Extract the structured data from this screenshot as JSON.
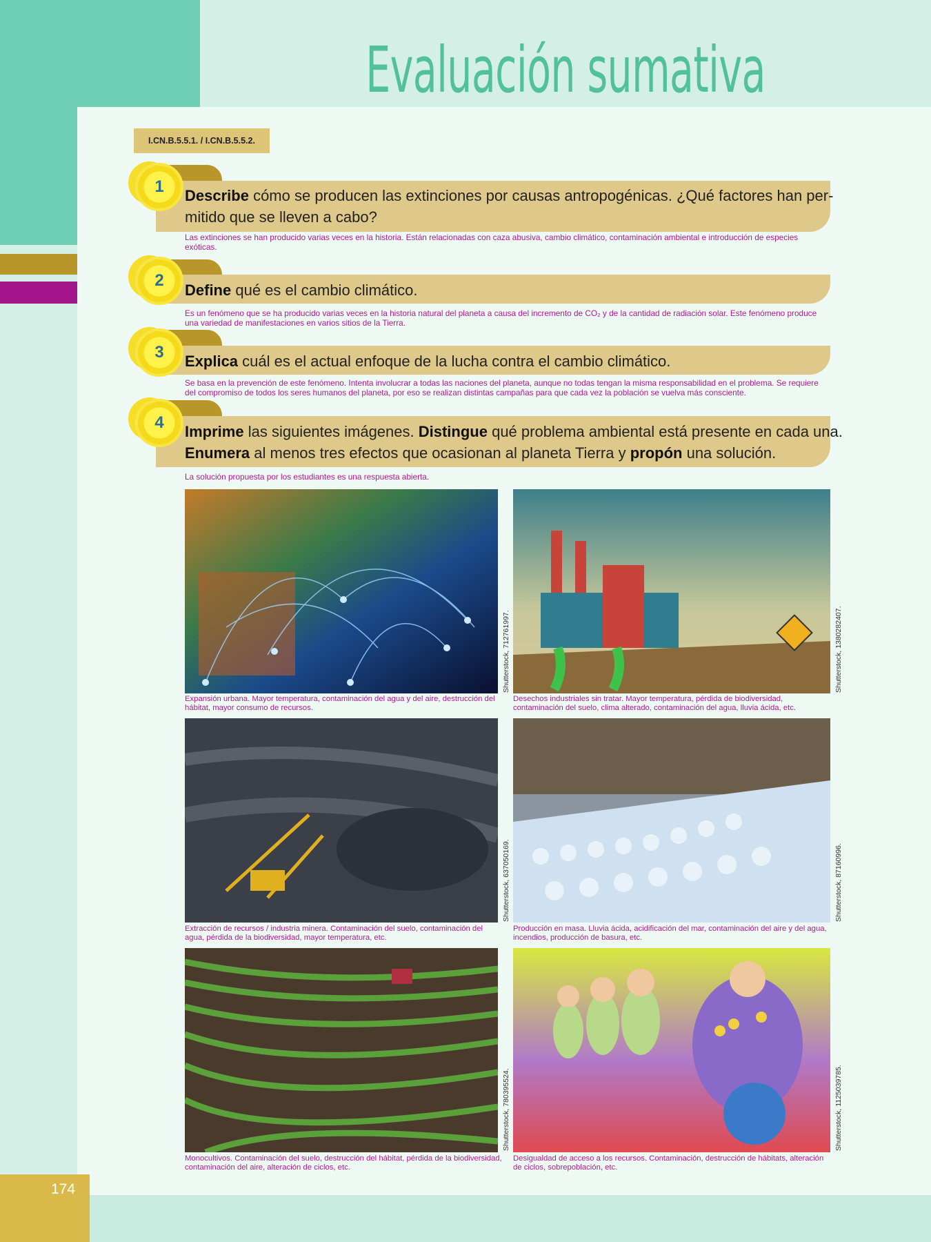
{
  "header": {
    "title": "Evaluación sumativa"
  },
  "indicator": "I.CN.B.5.5.1. / I.CN.B.5.5.2.",
  "questions": [
    {
      "num": "1",
      "verb": "Describe",
      "text": " cómo se producen las extinciones por causas antropogénicas. ¿Qué factores han per-",
      "text2": "mitido que se lleven a cabo?",
      "answer": "Las extinciones se han producido varias veces en la historia. Están relacionadas con caza abusiva, cambio climático, contaminación ambiental e introducción de especies exóticas."
    },
    {
      "num": "2",
      "verb": "Define",
      "text": " qué es el cambio climático.",
      "answer": "Es un fenómeno que se ha producido varias veces en la historia natural del planeta a causa del incremento de CO₂ y de la cantidad de radiación solar. Este fenómeno produce una variedad de manifestaciones en varios sitios de la Tierra."
    },
    {
      "num": "3",
      "verb": "Explica",
      "text": " cuál es el actual enfoque de la lucha contra el cambio climático.",
      "answer": "Se basa en la prevención de este fenómeno. Intenta involucrar a todas las naciones del planeta, aunque no todas tengan la misma responsabilidad en el problema. Se requiere del compromiso de todos los seres humanos del planeta, por eso se realizan distintas campañas para que cada vez la población se vuelva más consciente."
    },
    {
      "num": "4",
      "verb": "Imprime",
      "text": " las siguientes imágenes. ",
      "verb2": "Distingue",
      "text_b": " qué problema ambiental está presente en cada una.",
      "verb3": "Enumera",
      "text_c": " al menos tres efectos que ocasionan al planeta Tierra y ",
      "verb4": "propón",
      "text_d": " una solución.",
      "answer": "La solución propuesta por los estudiantes es una respuesta abierta."
    }
  ],
  "images": [
    {
      "credit": "Shutterstock, 712761997.",
      "caption": "Expansión urbana. Mayor temperatura, contaminación del agua y del aire, destrucción del hábitat, mayor consumo de recursos."
    },
    {
      "credit": "Shutterstock, 1380282407.",
      "caption": "Desechos industriales sin tratar. Mayor temperatura, pérdida de biodiversidad, contaminación del suelo, clima alterado, contaminación del agua, lluvia ácida, etc."
    },
    {
      "credit": "Shutterstock, 637050169.",
      "caption": "Extracción de recursos / industria minera. Contaminación del suelo, contaminación del agua, pérdida de la biodiversidad, mayor temperatura, etc."
    },
    {
      "credit": "Shutterstock, 87160996.",
      "caption": "Producción en masa. Lluvia ácida, acidificación del mar, contaminación del aire y del agua, incendios, producción de basura, etc."
    },
    {
      "credit": "Shutterstock, 780395524.",
      "caption": "Monocultivos. Contaminación del suelo, destrucción del hábitat, pérdida de la biodiversidad, contaminación del aire, alteración de ciclos, etc."
    },
    {
      "credit": "Shutterstock, 1125039785.",
      "caption": "Desigualdad de acceso a los recursos. Contaminación, destrucción de hábitats, alteración de ciclos, sobrepoblación, etc."
    }
  ],
  "footer": {
    "page_number": "174"
  }
}
